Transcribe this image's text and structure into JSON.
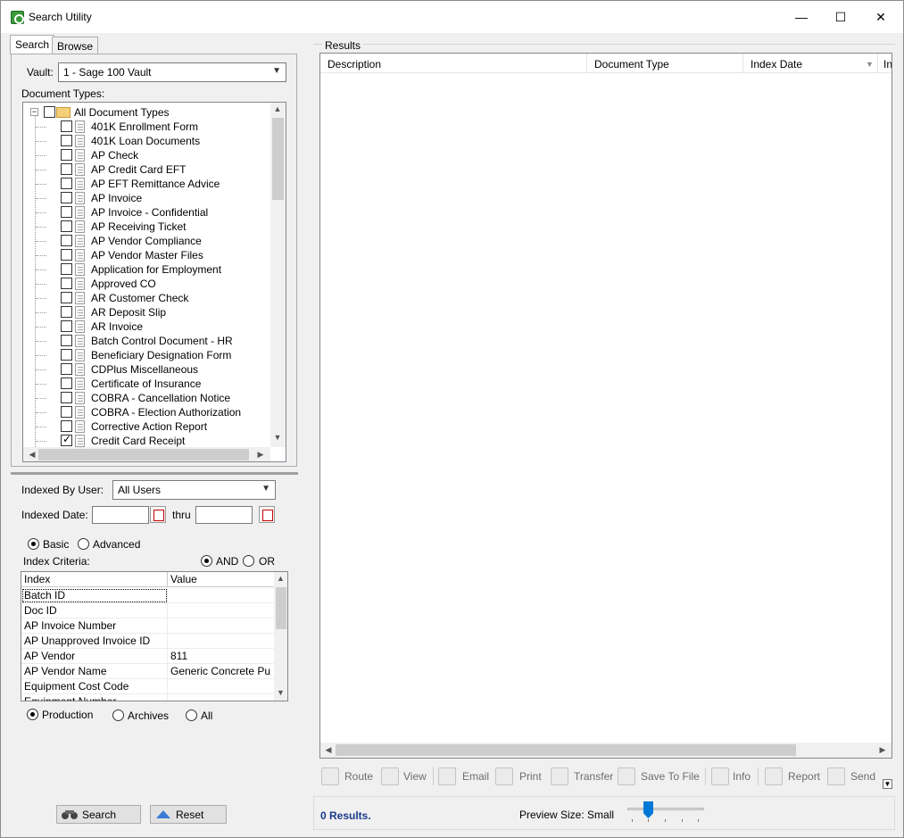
{
  "window": {
    "title": "Search Utility",
    "minimize": "—",
    "maximize": "☐",
    "close": "✕"
  },
  "tabs": [
    "Search",
    "Browse"
  ],
  "vault": {
    "label": "Vault:",
    "value": "1 - Sage 100 Vault"
  },
  "document_types": {
    "label": "Document Types:",
    "root": "All Document Types",
    "items": [
      {
        "label": "401K Enrollment Form",
        "checked": false
      },
      {
        "label": "401K Loan Documents",
        "checked": false
      },
      {
        "label": "AP Check",
        "checked": false
      },
      {
        "label": "AP Credit Card EFT",
        "checked": false
      },
      {
        "label": "AP EFT Remittance Advice",
        "checked": false
      },
      {
        "label": "AP Invoice",
        "checked": false
      },
      {
        "label": "AP Invoice - Confidential",
        "checked": false
      },
      {
        "label": "AP Receiving Ticket",
        "checked": false
      },
      {
        "label": "AP Vendor Compliance",
        "checked": false
      },
      {
        "label": "AP Vendor Master Files",
        "checked": false
      },
      {
        "label": "Application for Employment",
        "checked": false
      },
      {
        "label": "Approved CO",
        "checked": false
      },
      {
        "label": "AR Customer Check",
        "checked": false
      },
      {
        "label": "AR Deposit Slip",
        "checked": false
      },
      {
        "label": "AR Invoice",
        "checked": false
      },
      {
        "label": "Batch Control Document - HR",
        "checked": false
      },
      {
        "label": "Beneficiary Designation Form",
        "checked": false
      },
      {
        "label": "CDPlus Miscellaneous",
        "checked": false
      },
      {
        "label": "Certificate of Insurance",
        "checked": false
      },
      {
        "label": "COBRA - Cancellation Notice",
        "checked": false
      },
      {
        "label": "COBRA - Election Authorization",
        "checked": false
      },
      {
        "label": "Corrective Action Report",
        "checked": false
      },
      {
        "label": "Credit Card Receipt",
        "checked": true
      }
    ]
  },
  "indexed_by_user": {
    "label": "Indexed By User:",
    "value": "All Users"
  },
  "indexed_date": {
    "label": "Indexed Date:",
    "thru": "thru",
    "from": "",
    "to": ""
  },
  "mode": {
    "basic": "Basic",
    "advanced": "Advanced",
    "selected": "Basic"
  },
  "index_criteria": {
    "label": "Index Criteria:",
    "and": "AND",
    "or": "OR",
    "selected": "AND",
    "headers": [
      "Index",
      "Value"
    ],
    "rows": [
      {
        "index": "Batch ID",
        "value": ""
      },
      {
        "index": "Doc ID",
        "value": ""
      },
      {
        "index": "AP Invoice Number",
        "value": ""
      },
      {
        "index": "AP Unapproved Invoice ID",
        "value": ""
      },
      {
        "index": "AP Vendor",
        "value": "811"
      },
      {
        "index": "AP Vendor Name",
        "value": "Generic Concrete Pu"
      },
      {
        "index": "Equipment Cost Code",
        "value": ""
      },
      {
        "index": "Equipment Number",
        "value": ""
      }
    ]
  },
  "scope": {
    "production": "Production",
    "archives": "Archives",
    "all": "All",
    "selected": "Production"
  },
  "buttons": {
    "search": "Search",
    "reset": "Reset"
  },
  "results": {
    "label": "Results",
    "columns": [
      "Description",
      "Document Type",
      "Index Date",
      "In"
    ]
  },
  "toolbar": [
    "Route",
    "View",
    "Email",
    "Print",
    "Transfer",
    "Save To File",
    "Info",
    "Report",
    "Send"
  ],
  "status": {
    "count": "0 Results.",
    "preview_label": "Preview Size: Small",
    "preview_level": 0.25
  },
  "colors": {
    "accent": "#0078d7",
    "count_text": "#1a3a8a"
  }
}
